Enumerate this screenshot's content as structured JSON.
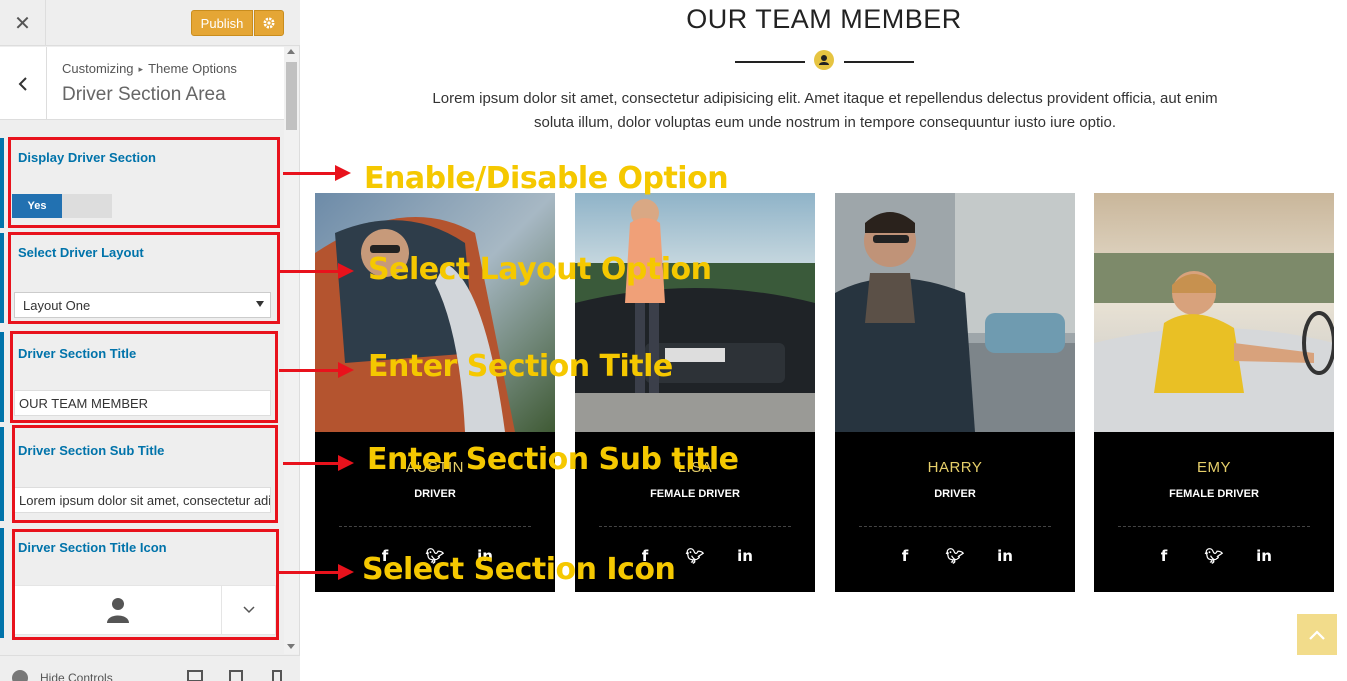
{
  "sidebar": {
    "close_icon": "close-icon",
    "publish_label": "Publish",
    "breadcrumb": [
      "Customizing",
      "Theme Options"
    ],
    "section_title": "Driver Section Area",
    "controls": {
      "display": {
        "label": "Display Driver Section",
        "toggle_value": "Yes"
      },
      "layout": {
        "label": "Select Driver Layout",
        "selected": "Layout One"
      },
      "title": {
        "label": "Driver Section Title",
        "value": "OUR TEAM MEMBER"
      },
      "subtitle": {
        "label": "Driver Section Sub Title",
        "value": "Lorem ipsum dolor sit amet, consectetur adipisicing elit."
      },
      "icon": {
        "label": "Dirver Section Title Icon",
        "selected_icon": "user-icon"
      }
    },
    "footer": {
      "hide_controls": "Hide Controls",
      "devices": [
        "desktop",
        "tablet",
        "mobile"
      ]
    }
  },
  "preview": {
    "title": "OUR TEAM MEMBER",
    "description": "Lorem ipsum dolor sit amet, consectetur adipisicing elit. Amet itaque et repellendus delectus provident officia, aut enim soluta illum, dolor voluptas eum unde nostrum in tempore consequuntur iusto iure optio.",
    "accent_color": "#e6c441",
    "team": [
      {
        "name": "AUSTIN",
        "role": "DRIVER"
      },
      {
        "name": "LISA",
        "role": "FEMALE DRIVER"
      },
      {
        "name": "HARRY",
        "role": "DRIVER"
      },
      {
        "name": "EMY",
        "role": "FEMALE DRIVER"
      }
    ],
    "social_icons": [
      "facebook-icon",
      "twitter-icon",
      "linkedin-icon"
    ]
  },
  "annotations": [
    "Enable/Disable Option",
    "Select Layout Option",
    "Enter Section Title",
    "Enter Section Sub title",
    "Select Section Icon"
  ],
  "colors": {
    "publish": "#e5a635",
    "customizer_blue": "#0073aa",
    "annotation_red": "#e8121c",
    "annotation_yellow": "#f5c800"
  }
}
